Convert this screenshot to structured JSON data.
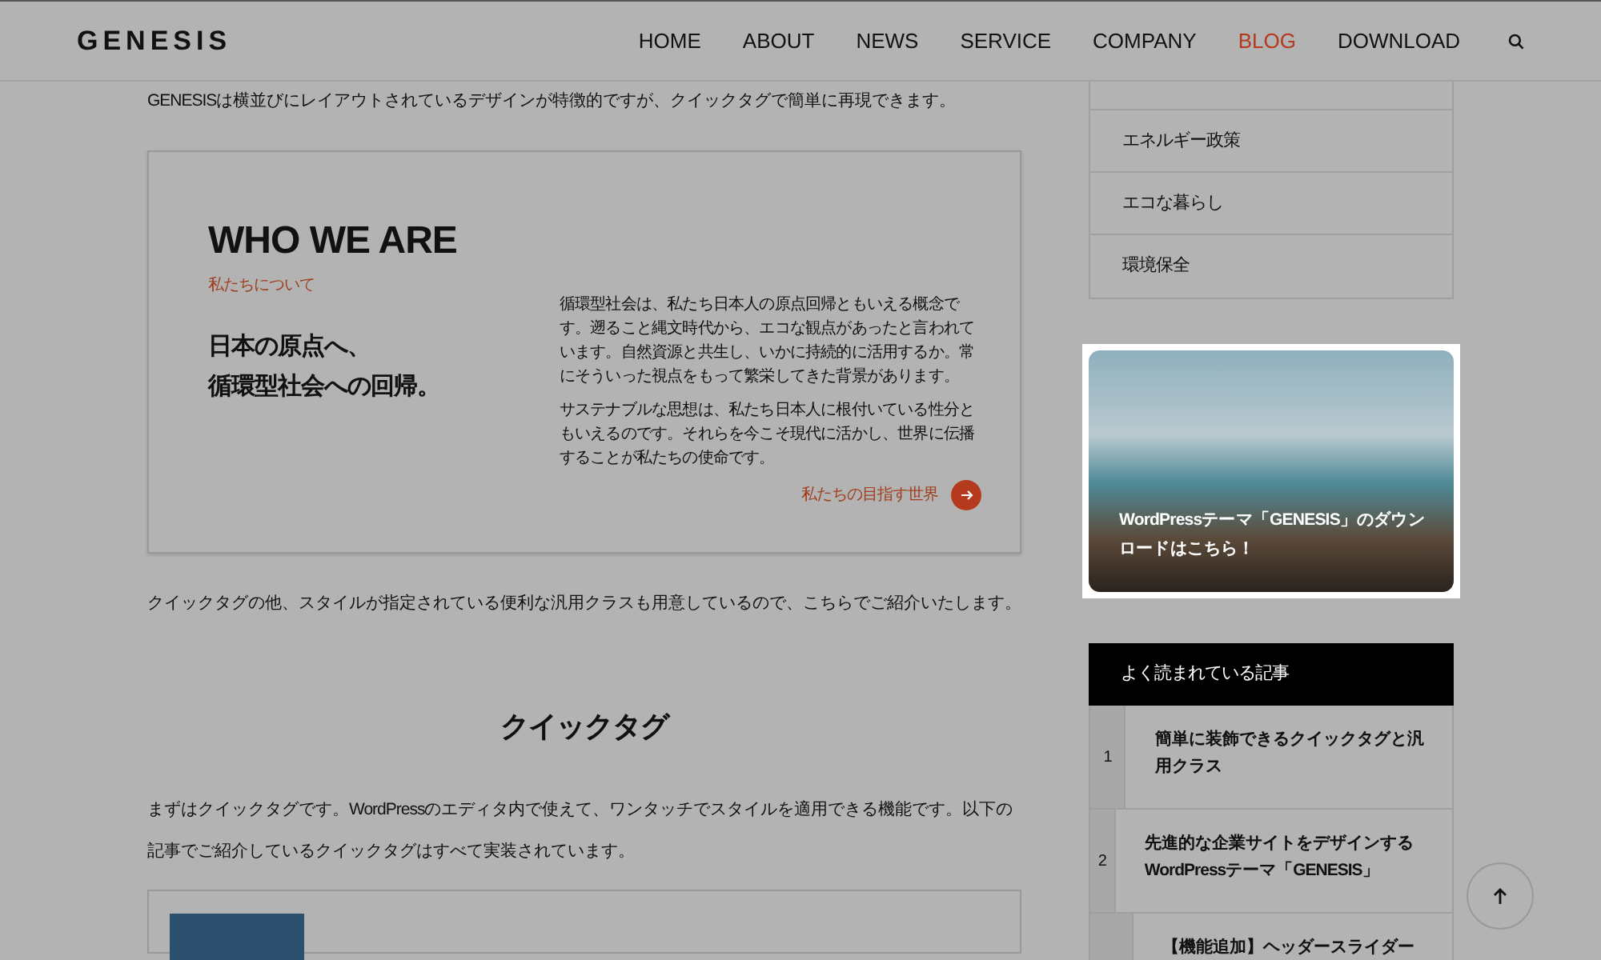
{
  "header": {
    "logo": "GENESIS",
    "nav": [
      {
        "label": "HOME",
        "selected": false
      },
      {
        "label": "ABOUT",
        "selected": false
      },
      {
        "label": "NEWS",
        "selected": false
      },
      {
        "label": "SERVICE",
        "selected": false
      },
      {
        "label": "COMPANY",
        "selected": false
      },
      {
        "label": "BLOG",
        "selected": true
      },
      {
        "label": "DOWNLOAD",
        "selected": false
      }
    ]
  },
  "article": {
    "intro": "GENESISは横並びにレイアウトされているデザインが特徴的ですが、クイックタグで簡単に再現できます。",
    "sample_card": {
      "title": "WHO WE ARE",
      "subtitle": "私たちについて",
      "heading_lines": [
        "日本の原点へ、",
        "循環型社会への回帰。"
      ],
      "body": [
        "循環型社会は、私たち日本人の原点回帰ともいえる概念です。遡ること縄文時代から、エコな観点があったと言われています。自然資源と共生し、いかに持続的に活用するか。常にそういった視点をもって繁栄してきた背景があります。",
        "サステナブルな思想は、私たち日本人に根付いている性分ともいえるのです。それらを今こそ現代に活かし、世界に伝播することが私たちの使命です。"
      ],
      "link": "私たちの目指す世界"
    },
    "paragraph": "クイックタグの他、スタイルが指定されている便利な汎用クラスも用意しているので、こちらでご紹介いたします。",
    "section_heading": "クイックタグ",
    "section_text": "まずはクイックタグです。WordPressのエディタ内で使えて、ワンタッチでスタイルを適用できる機能です。以下の記事でご紹介しているクイックタグはすべて実装されています。"
  },
  "sidebar": {
    "categories": [
      "エネルギー政策",
      "エコな暮らし",
      "環境保全"
    ],
    "banner": {
      "text": "WordPressテーマ「GENESIS」のダウンロードはこちら！"
    },
    "ranking": {
      "title": "よく読まれている記事",
      "items": [
        {
          "rank": "1",
          "title": "簡単に装飾できるクイックタグと汎用クラス"
        },
        {
          "rank": "2",
          "title": "先進的な企業サイトをデザインするWordPressテーマ「GENESIS」"
        },
        {
          "title": "【機能追加】ヘッダースライダー"
        }
      ]
    }
  }
}
